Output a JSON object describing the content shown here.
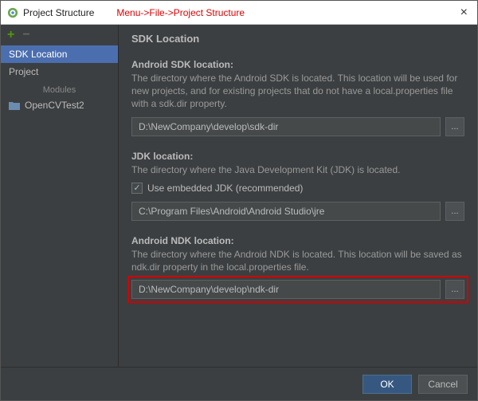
{
  "window": {
    "title": "Project Structure",
    "breadcrumb": "Menu->File->Project Structure"
  },
  "sidebar": {
    "items": [
      {
        "label": "SDK Location"
      },
      {
        "label": "Project"
      }
    ],
    "modules_header": "Modules",
    "modules": [
      {
        "label": "OpenCVTest2"
      }
    ]
  },
  "main": {
    "title": "SDK Location",
    "sdk": {
      "label": "Android SDK location:",
      "desc": "The directory where the Android SDK is located. This location will be used for new projects, and for existing projects that do not have a local.properties file with a sdk.dir property.",
      "value": "D:\\NewCompany\\develop\\sdk-dir"
    },
    "jdk": {
      "label": "JDK location:",
      "desc": "The directory where the Java Development Kit (JDK) is located.",
      "checkbox_label": "Use embedded JDK (recommended)",
      "value": "C:\\Program Files\\Android\\Android Studio\\jre"
    },
    "ndk": {
      "label": "Android NDK location:",
      "desc": "The directory where the Android NDK is located. This location will be saved as ndk.dir property in the local.properties file.",
      "value": "D:\\NewCompany\\develop\\ndk-dir"
    },
    "browse": "..."
  },
  "footer": {
    "ok": "OK",
    "cancel": "Cancel"
  }
}
